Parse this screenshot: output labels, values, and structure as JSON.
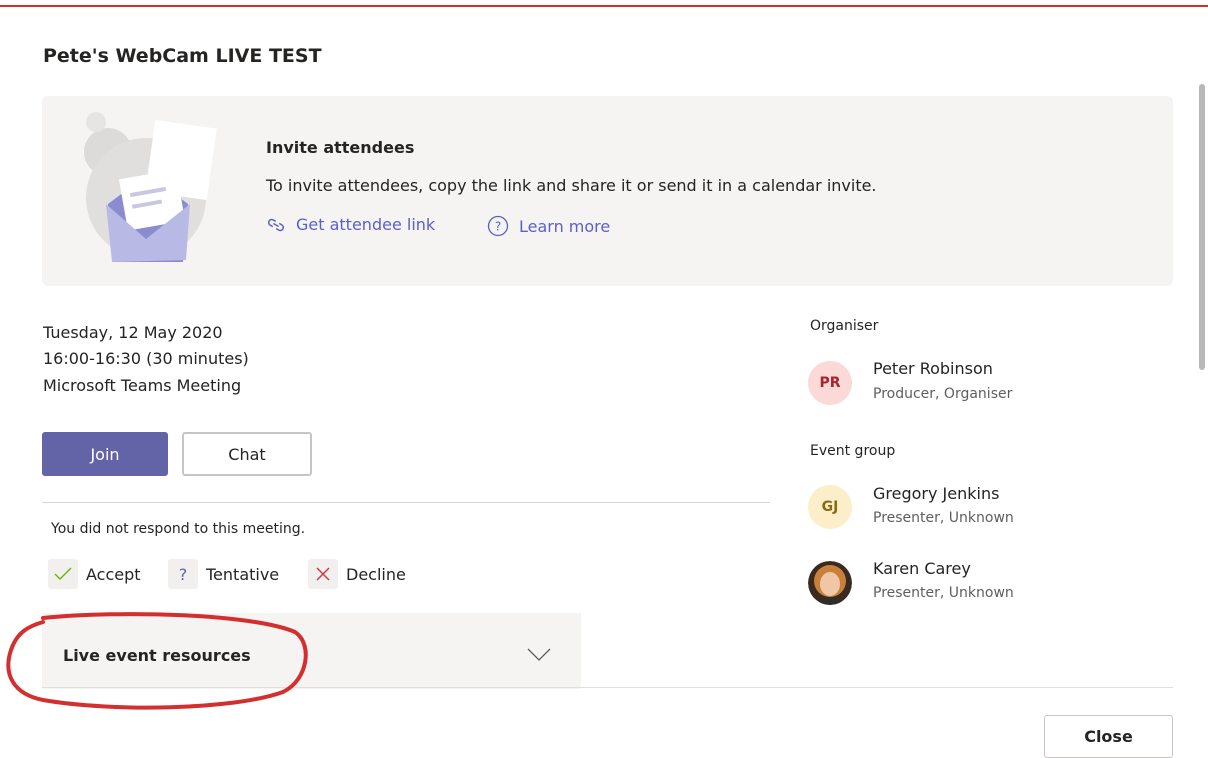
{
  "dialog": {
    "title": "Pete's WebCam LIVE TEST",
    "close_label": "Close"
  },
  "invite": {
    "heading": "Invite attendees",
    "text": "To invite attendees, copy the link and share it or send it in a calendar invite.",
    "get_link_label": "Get attendee link",
    "learn_more_label": "Learn more"
  },
  "meeting": {
    "date": "Tuesday, 12 May 2020",
    "time": "16:00-16:30 (30 minutes)",
    "type": "Microsoft Teams Meeting",
    "join_label": "Join",
    "chat_label": "Chat",
    "response_status": "You did not respond to this meeting.",
    "rsvp": {
      "accept": "Accept",
      "tentative": "Tentative",
      "decline": "Decline"
    },
    "resources_label": "Live event resources"
  },
  "organiser": {
    "section_label": "Organiser",
    "people": [
      {
        "initials": "PR",
        "name": "Peter Robinson",
        "role": "Producer, Organiser"
      }
    ]
  },
  "event_group": {
    "section_label": "Event group",
    "people": [
      {
        "initials": "GJ",
        "name": "Gregory Jenkins",
        "role": "Presenter, Unknown"
      },
      {
        "name": "Karen Carey",
        "role": "Presenter, Unknown"
      }
    ]
  },
  "colors": {
    "accent": "#6264a7",
    "link": "#5b5fc7",
    "annotation": "#d32f2f",
    "avatar_pr_bg": "#fbd9d6",
    "avatar_pr_fg": "#a4262c",
    "avatar_gj_bg": "#fbeec9",
    "avatar_gj_fg": "#8a6914"
  }
}
